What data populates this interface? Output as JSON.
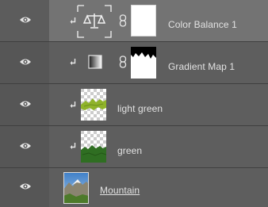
{
  "layers": [
    {
      "name": "Color Balance 1",
      "selected": true,
      "kind": "adjustment",
      "icon": "balance-scale-icon"
    },
    {
      "name": "Gradient Map 1",
      "selected": false,
      "kind": "adjustment",
      "icon": "gradient-map-icon"
    },
    {
      "name": "light green",
      "selected": false,
      "kind": "pixel",
      "icon": "transparent-thumbnail"
    },
    {
      "name": "green",
      "selected": false,
      "kind": "pixel",
      "icon": "transparent-thumbnail"
    },
    {
      "name": "Mountain",
      "selected": false,
      "kind": "pixel",
      "icon": "photo-thumbnail"
    }
  ],
  "colors": {
    "panel_bg": "#5e5e5e",
    "selected_bg": "#737373",
    "text": "#e2e2e2",
    "grass_light": "#8fb32a",
    "grass_dark": "#2f6e22"
  }
}
